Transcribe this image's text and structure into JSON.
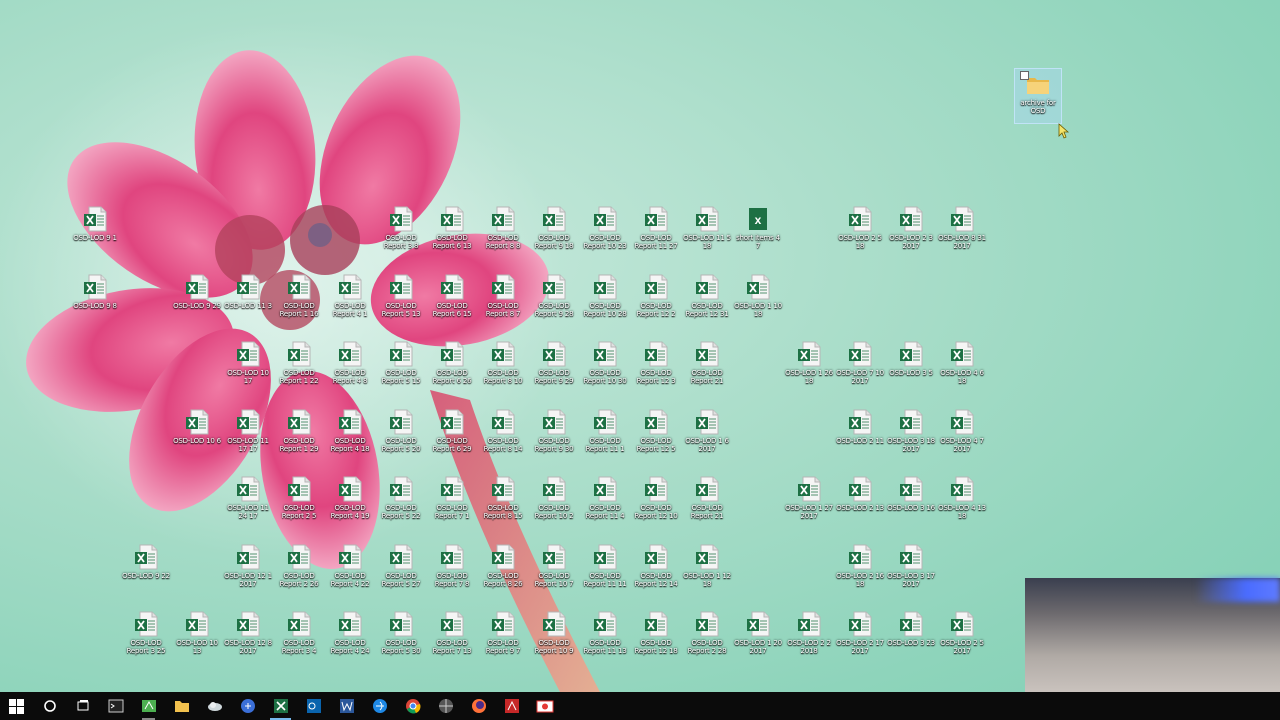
{
  "desktop": {
    "icons": [
      {
        "label": "OSD-LOD 9 1",
        "col": 2,
        "row": 0
      },
      {
        "label": "OSD-LOD Report 3 8",
        "col": 8,
        "row": 0
      },
      {
        "label": "OSD-LOD Report 6 13",
        "col": 9,
        "row": 0
      },
      {
        "label": "OSD-LOD Report 8 8",
        "col": 10,
        "row": 0
      },
      {
        "label": "OSD-LOD Report 9 18",
        "col": 11,
        "row": 0
      },
      {
        "label": "OSD-LOD Report 10 23",
        "col": 12,
        "row": 0
      },
      {
        "label": "OSD-LOD Report 11 27",
        "col": 13,
        "row": 0
      },
      {
        "label": "OSD-LOD 11 5 18",
        "col": 14,
        "row": 0
      },
      {
        "label": "short items 4 7",
        "col": 15,
        "row": 0,
        "solid": true
      },
      {
        "label": "OSD-LOD 2 5 18",
        "col": 17,
        "row": 0
      },
      {
        "label": "OSD-LOD 2 3 2017",
        "col": 18,
        "row": 0
      },
      {
        "label": "OSD-LOD 8 31 2017",
        "col": 19,
        "row": 0
      },
      {
        "label": "OSD-LOD 9 8",
        "col": 2,
        "row": 1
      },
      {
        "label": "OSD-LOD 9 29",
        "col": 4,
        "row": 1
      },
      {
        "label": "OSD-LOD 11 3",
        "col": 5,
        "row": 1
      },
      {
        "label": "OSD-LOD Report 1 16",
        "col": 6,
        "row": 1
      },
      {
        "label": "OSD-LOD Report 4 1",
        "col": 7,
        "row": 1
      },
      {
        "label": "OSD-LOD Report 5 13",
        "col": 8,
        "row": 1
      },
      {
        "label": "OSD-LOD Report 6 15",
        "col": 9,
        "row": 1
      },
      {
        "label": "OSD-LOD Report 8 7",
        "col": 10,
        "row": 1
      },
      {
        "label": "OSD-LOD Report 9 28",
        "col": 11,
        "row": 1
      },
      {
        "label": "OSD-LOD Report 10 28",
        "col": 12,
        "row": 1
      },
      {
        "label": "OSD-LOD Report 12 2",
        "col": 13,
        "row": 1
      },
      {
        "label": "OSD-LOD Report 12 31",
        "col": 14,
        "row": 1
      },
      {
        "label": "OSD-LOD 1 10 18",
        "col": 15,
        "row": 1
      },
      {
        "label": "OSD-LOD 10 17",
        "col": 5,
        "row": 2
      },
      {
        "label": "OSD-LOD Report 1 22",
        "col": 6,
        "row": 2
      },
      {
        "label": "OSD-LOD Report 4 8",
        "col": 7,
        "row": 2
      },
      {
        "label": "OSD-LOD Report 5 15",
        "col": 8,
        "row": 2
      },
      {
        "label": "OSD-LOD Report 6 26",
        "col": 9,
        "row": 2
      },
      {
        "label": "OSD-LOD Report 8 10",
        "col": 10,
        "row": 2
      },
      {
        "label": "OSD-LOD Report 9 29",
        "col": 11,
        "row": 2
      },
      {
        "label": "OSD-LOD Report 10 30",
        "col": 12,
        "row": 2
      },
      {
        "label": "OSD-LOD Report 12 3",
        "col": 13,
        "row": 2
      },
      {
        "label": "OSD-LOD Report 21",
        "col": 14,
        "row": 2
      },
      {
        "label": "OSD-LOD 1 26 18",
        "col": 16,
        "row": 2
      },
      {
        "label": "OSD-LOD 7 10 2017",
        "col": 17,
        "row": 2
      },
      {
        "label": "OSD-LOD 3 5",
        "col": 18,
        "row": 2
      },
      {
        "label": "OSD-LOD 4 6 18",
        "col": 19,
        "row": 2
      },
      {
        "label": "OSD-LOD 10 6",
        "col": 4,
        "row": 3
      },
      {
        "label": "OSD-LOD 11 17 17",
        "col": 5,
        "row": 3
      },
      {
        "label": "OSD-LOD Report 1 29",
        "col": 6,
        "row": 3
      },
      {
        "label": "OSD-LOD Report 4 18",
        "col": 7,
        "row": 3
      },
      {
        "label": "OSD-LOD Report 5 20",
        "col": 8,
        "row": 3
      },
      {
        "label": "OSD-LOD Report 6 29",
        "col": 9,
        "row": 3
      },
      {
        "label": "OSD-LOD Report 8 14",
        "col": 10,
        "row": 3
      },
      {
        "label": "OSD-LOD Report 9 30",
        "col": 11,
        "row": 3
      },
      {
        "label": "OSD-LOD Report 11 1",
        "col": 12,
        "row": 3
      },
      {
        "label": "OSD-LOD Report 12 5",
        "col": 13,
        "row": 3
      },
      {
        "label": "OSD-LOD 1 6 2017",
        "col": 14,
        "row": 3
      },
      {
        "label": "OSD-LOD 2 11",
        "col": 17,
        "row": 3
      },
      {
        "label": "OSD-LOD 3 18 2017",
        "col": 18,
        "row": 3
      },
      {
        "label": "OSD-LOD 4 7 2017",
        "col": 19,
        "row": 3
      },
      {
        "label": "OSD-LOD 11 24 17",
        "col": 5,
        "row": 4
      },
      {
        "label": "OSD-LOD Report 2 5",
        "col": 6,
        "row": 4
      },
      {
        "label": "OSD-LOD Report 4 19",
        "col": 7,
        "row": 4
      },
      {
        "label": "OSD-LOD Report 5 22",
        "col": 8,
        "row": 4
      },
      {
        "label": "OSD-LOD Report 7 1",
        "col": 9,
        "row": 4
      },
      {
        "label": "OSD-LOD Report 8 15",
        "col": 10,
        "row": 4
      },
      {
        "label": "OSD-LOD Report 10 2",
        "col": 11,
        "row": 4
      },
      {
        "label": "OSD-LOD Report 11 4",
        "col": 12,
        "row": 4
      },
      {
        "label": "OSD-LOD Report 12 10",
        "col": 13,
        "row": 4
      },
      {
        "label": "OSD-LOD Report 21",
        "col": 14,
        "row": 4
      },
      {
        "label": "OSD-LOD 1 27 2017",
        "col": 16,
        "row": 4
      },
      {
        "label": "OSD-LOD 2 13",
        "col": 17,
        "row": 4
      },
      {
        "label": "OSD-LOD 3 16",
        "col": 18,
        "row": 4
      },
      {
        "label": "OSD-LOD 4 13 18",
        "col": 19,
        "row": 4
      },
      {
        "label": "OSD-LOD 9 22",
        "col": 3,
        "row": 5
      },
      {
        "label": "OSD-LOD 12 1 2017",
        "col": 5,
        "row": 5
      },
      {
        "label": "OSD-LOD Report 2 26",
        "col": 6,
        "row": 5
      },
      {
        "label": "OSD-LOD Report 4 22",
        "col": 7,
        "row": 5
      },
      {
        "label": "OSD-LOD Report 5 27",
        "col": 8,
        "row": 5
      },
      {
        "label": "OSD-LOD Report 7 8",
        "col": 9,
        "row": 5
      },
      {
        "label": "OSD-LOD Report 8 26",
        "col": 10,
        "row": 5
      },
      {
        "label": "OSD-LOD Report 10 7",
        "col": 11,
        "row": 5
      },
      {
        "label": "OSD-LOD Report 11 11",
        "col": 12,
        "row": 5
      },
      {
        "label": "OSD-LOD Report 12 14",
        "col": 13,
        "row": 5
      },
      {
        "label": "OSD-LOD 1 12 18",
        "col": 14,
        "row": 5
      },
      {
        "label": "OSD-LOD 2 16 18",
        "col": 17,
        "row": 5
      },
      {
        "label": "OSD-LOD 3 17 2017",
        "col": 18,
        "row": 5
      },
      {
        "label": "OSD-LOD Report 3 25",
        "col": 3,
        "row": 6
      },
      {
        "label": "OSD-LOD 10 13",
        "col": 4,
        "row": 6
      },
      {
        "label": "OSD-LOD 12 8 2017",
        "col": 5,
        "row": 6
      },
      {
        "label": "OSD-LOD Report 3 4",
        "col": 6,
        "row": 6
      },
      {
        "label": "OSD-LOD Report 4 24",
        "col": 7,
        "row": 6
      },
      {
        "label": "OSD-LOD Report 5 30",
        "col": 8,
        "row": 6
      },
      {
        "label": "OSD-LOD Report 7 13",
        "col": 9,
        "row": 6
      },
      {
        "label": "OSD-LOD Report 9 7",
        "col": 10,
        "row": 6
      },
      {
        "label": "OSD-LOD Report 10 9",
        "col": 11,
        "row": 6
      },
      {
        "label": "OSD-LOD Report 11 13",
        "col": 12,
        "row": 6
      },
      {
        "label": "OSD-LOD Report 12 18",
        "col": 13,
        "row": 6
      },
      {
        "label": "OSD-LOD Report 2 28",
        "col": 14,
        "row": 6
      },
      {
        "label": "OSD-LOD 1 20 2017",
        "col": 15,
        "row": 6
      },
      {
        "label": "OSD-LOD 2 2 2018",
        "col": 16,
        "row": 6
      },
      {
        "label": "OSD-LOD 2 17 2017",
        "col": 17,
        "row": 6
      },
      {
        "label": "OSD-LOD 3 23",
        "col": 18,
        "row": 6
      },
      {
        "label": "OSD-LOD 2 5 2017",
        "col": 19,
        "row": 6
      }
    ],
    "folder": {
      "label": "archive for OSD"
    }
  },
  "taskbar": {
    "items": [
      {
        "name": "windows-start-icon",
        "kind": "start"
      },
      {
        "name": "cortana-search-icon",
        "kind": "cortana"
      },
      {
        "name": "task-view-icon",
        "kind": "taskview"
      },
      {
        "name": "command-prompt-icon",
        "kind": "cmd"
      },
      {
        "name": "app-green-icon",
        "kind": "green",
        "state": "open"
      },
      {
        "name": "file-explorer-icon",
        "kind": "folder"
      },
      {
        "name": "cloud-app-icon",
        "kind": "cloud"
      },
      {
        "name": "blue-app-icon",
        "kind": "bluecircle"
      },
      {
        "name": "excel-icon",
        "kind": "excel",
        "state": "active"
      },
      {
        "name": "outlook-icon",
        "kind": "outlook"
      },
      {
        "name": "word-icon",
        "kind": "word"
      },
      {
        "name": "edge-icon",
        "kind": "edge"
      },
      {
        "name": "chrome-icon",
        "kind": "chrome"
      },
      {
        "name": "globe-app-icon",
        "kind": "globe"
      },
      {
        "name": "firefox-icon",
        "kind": "firefox"
      },
      {
        "name": "acrobat-icon",
        "kind": "acrobat"
      },
      {
        "name": "camera-app-icon",
        "kind": "camera"
      }
    ]
  },
  "colors": {
    "excel_green": "#1d7044",
    "wallpaper_mint": "#a9ddc9",
    "flower_pink": "#e0457f",
    "taskbar": "#0b0b0b"
  }
}
